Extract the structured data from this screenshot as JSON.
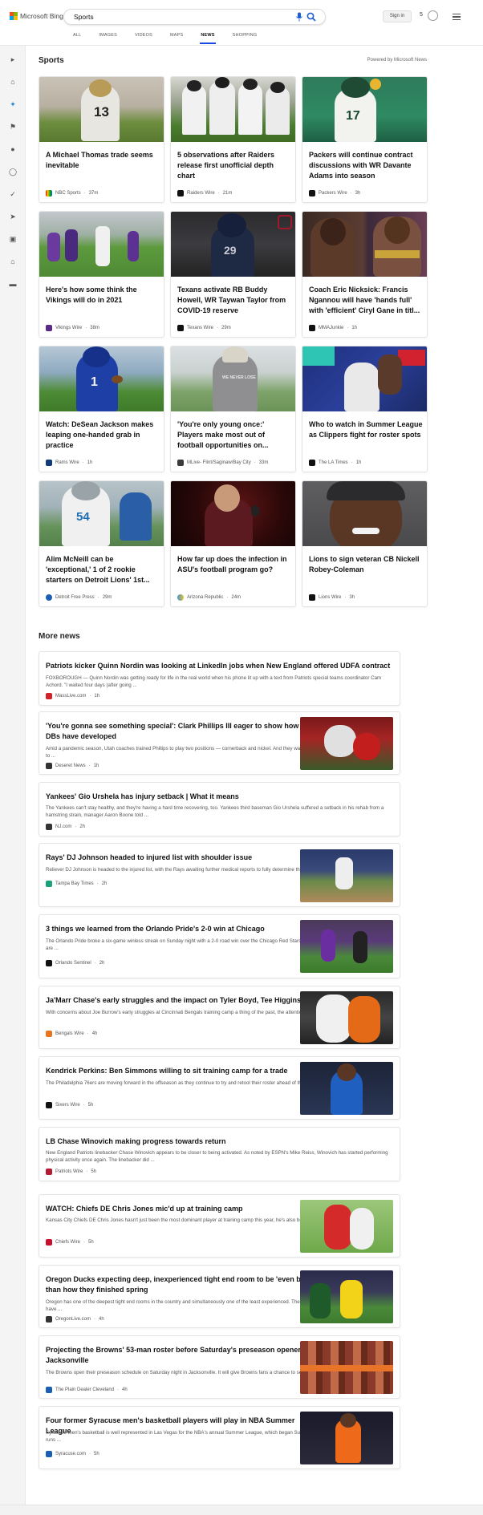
{
  "header": {
    "logo_text": "Microsoft Bing",
    "search_value": "Sports",
    "tabs": [
      "ALL",
      "IMAGES",
      "VIDEOS",
      "MAPS",
      "NEWS",
      "SHOPPING"
    ],
    "active_tab": "NEWS",
    "signin_label": "Sign in",
    "rewards_count": "5"
  },
  "sidebar": {
    "icons": [
      "expand-arrow-icon",
      "home-icon",
      "sports-icon",
      "flag-icon",
      "location-pin-icon",
      "globe-icon",
      "microscope-icon",
      "rocket-icon",
      "film-icon",
      "bank-icon",
      "card-icon"
    ]
  },
  "sports": {
    "title": "Sports",
    "powered_by": "Powered by Microsoft News",
    "cards": [
      {
        "title": "A Michael Thomas trade seems inevitable",
        "source": "NBC Sports",
        "time": "37m"
      },
      {
        "title": "5 observations after Raiders release first unofficial depth chart",
        "source": "Raiders Wire",
        "time": "21m"
      },
      {
        "title": "Packers will continue contract discussions with WR Davante Adams into season",
        "source": "Packers Wire",
        "time": "3h"
      },
      {
        "title": "Here's how some think the Vikings will do in 2021",
        "source": "Vikings Wire",
        "time": "38m"
      },
      {
        "title": "Texans activate RB Buddy Howell, WR Taywan Taylor from COVID-19 reserve",
        "source": "Texans Wire",
        "time": "29m"
      },
      {
        "title": "Coach Eric Nicksick: Francis Ngannou will have 'hands full' with 'efficient' Ciryl Gane in titl...",
        "source": "MMAJunkie",
        "time": "1h"
      },
      {
        "title": "Watch: DeSean Jackson makes leaping one-handed grab in practice",
        "source": "Rams Wire",
        "time": "1h"
      },
      {
        "title": "'You're only young once:' Players make most out of football opportunities on...",
        "source": "MLive- Flint/Saginaw/Bay City",
        "time": "33m"
      },
      {
        "title": "Who to watch in Summer League as Clippers fight for roster spots",
        "source": "The LA Times",
        "time": "1h"
      },
      {
        "title": "Alim McNeill can be 'exceptional,' 1 of 2 rookie starters on Detroit Lions' 1st...",
        "source": "Detroit Free Press",
        "time": "29m"
      },
      {
        "title": "How far up does the infection in ASU's football program go?",
        "source": "Arizona Republic",
        "time": "24m"
      },
      {
        "title": "Lions to sign veteran CB Nickell Robey-Coleman",
        "source": "Lions Wire",
        "time": "3h"
      }
    ]
  },
  "more_news": {
    "title": "More news",
    "items": [
      {
        "title": "Patriots kicker Quinn Nordin was looking at LinkedIn jobs when New England offered UDFA contract",
        "snippet": "FOXBOROUGH — Quinn Nordin was getting ready for life in the real world when his phone lit up with a text from Patriots special teams coordinator Cam Achord. \"I waited four days (after going ...",
        "source": "MassLive.com",
        "time": "1h"
      },
      {
        "title": "'You're gonna see something special': Clark Phillips III eager to show how much DBs have developed",
        "snippet": "Amid a pandemic season, Utah coaches trained Phillips to play two positions — cornerback and nickel. And they wanted him to ...",
        "source": "Deseret News",
        "time": "1h"
      },
      {
        "title": "Yankees' Gio Urshela has injury setback | What it means",
        "snippet": "The Yankees can't stay healthy, and they're having a hard time recovering, too. Yankees third baseman Gio Urshela suffered a setback in his rehab from a hamstring strain, manager Aaron Boone told ...",
        "source": "NJ.com",
        "time": "2h"
      },
      {
        "title": "Rays' DJ Johnson headed to injured list with shoulder issue",
        "snippet": "Reliever DJ Johnson is headed to the injured list, with the Rays awaiting further medical reports to fully determine the ...",
        "source": "Tampa Bay Times",
        "time": "2h"
      },
      {
        "title": "3 things we learned from the Orlando Pride's 2-0 win at Chicago",
        "snippet": "The Orlando Pride broke a six-game winless streak on Sunday night with a 2-0 road win over the Chicago Red Stars. Here are ...",
        "source": "Orlando Sentinel",
        "time": "2h"
      },
      {
        "title": "Ja'Marr Chase's early struggles and the impact on Tyler Boyd, Tee Higgins",
        "snippet": "With concerns about Joe Burrow's early struggles at Cincinnati Bengals training camp a thing of the past, the attention now ...",
        "source": "Bengals Wire",
        "time": "4h"
      },
      {
        "title": "Kendrick Perkins: Ben Simmons willing to sit training camp for a trade",
        "snippet": "The Philadelphia 76ers are moving forward in the offseason as they continue to try and retool their roster ahead of the ...",
        "source": "Sixers Wire",
        "time": "5h"
      },
      {
        "title": "LB Chase Winovich making progress towards return",
        "snippet": "New England Patriots linebacker Chase Winovich appears to be closer to being activated. As noted by ESPN's Mike Reiss, Winovich has started performing physical activity once again. The linebacker did ...",
        "source": "Patriots Wire",
        "time": "5h"
      },
      {
        "title": "WATCH: Chiefs DE Chris Jones mic'd up at training camp",
        "snippet": "Kansas City Chiefs DE Chris Jones hasn't just been the most dominant player at training camp this year, he's also been the ...",
        "source": "Chiefs Wire",
        "time": "5h"
      },
      {
        "title": "Oregon Ducks expecting deep, inexperienced tight end room to be 'even better' than how they finished spring",
        "snippet": "Oregon has one of the deepest tight end rooms in the country and simultaneously one of the least experienced. The Ducks have ...",
        "source": "OregonLive.com",
        "time": "4h"
      },
      {
        "title": "Projecting the Browns' 53-man roster before Saturday's preseason opener in Jacksonville",
        "snippet": "The Browns open their preseason schedule on Saturday night in Jacksonville. It will give Browns fans a chance to see their ...",
        "source": "The Plain Dealer Cleveland",
        "time": "4h"
      },
      {
        "title": "Four former Syracuse men's basketball players will play in NBA Summer League",
        "snippet": "Syracuse men's basketball is well represented in Las Vegas for the NBA's annual Summer League, which began Sunday and runs ...",
        "source": "Syracuse.com",
        "time": "5h"
      }
    ]
  },
  "colors": {
    "accent": "#174ae4",
    "card_border": "#e4e4e4",
    "sidebar_bg": "#f4f4f4"
  }
}
